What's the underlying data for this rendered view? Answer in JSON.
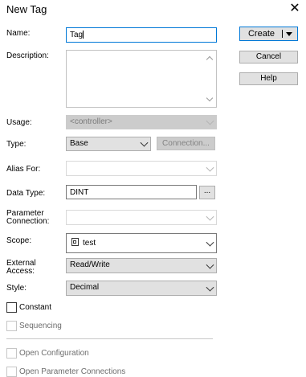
{
  "window": {
    "title": "New Tag",
    "close_glyph": "✕"
  },
  "buttons": {
    "create": "Create",
    "cancel": "Cancel",
    "help": "Help",
    "connection": "Connection...",
    "datatype_browse": "..."
  },
  "labels": {
    "name": "Name:",
    "description": "Description:",
    "usage": "Usage:",
    "type": "Type:",
    "alias_for": "Alias For:",
    "data_type": "Data Type:",
    "parameter_connection_1": "Parameter",
    "parameter_connection_2": "Connection:",
    "scope": "Scope:",
    "external_access_1": "External",
    "external_access_2": "Access:",
    "style": "Style:"
  },
  "fields": {
    "name_value": "Tag",
    "usage_value": "<controller>",
    "type_value": "Base",
    "data_type_value": "DINT",
    "scope_value": "test",
    "external_access_value": "Read/Write",
    "style_value": "Decimal"
  },
  "checkboxes": {
    "constant": "Constant",
    "sequencing": "Sequencing",
    "open_configuration": "Open Configuration",
    "open_parameter_connections": "Open Parameter Connections"
  }
}
